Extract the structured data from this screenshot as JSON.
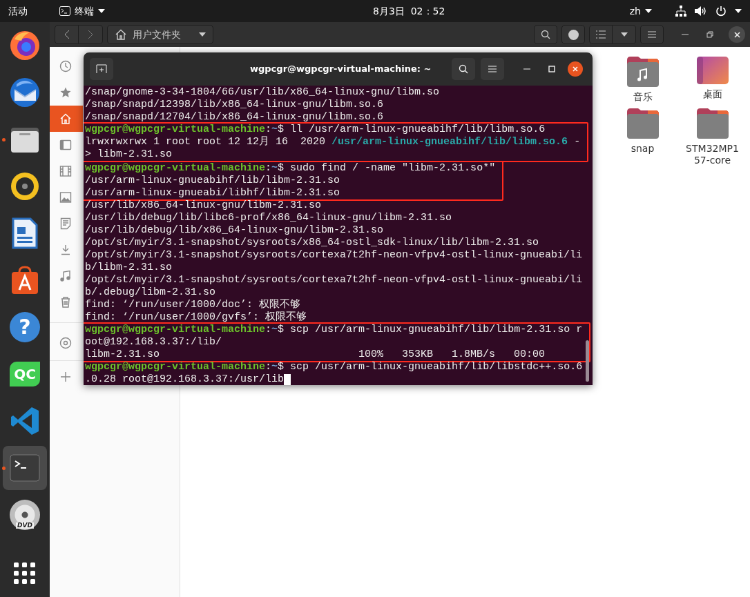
{
  "top_bar": {
    "activities": "活动",
    "app_name": "终端",
    "clock": "8月3日  02：52",
    "input_method": "zh"
  },
  "dock": [
    {
      "kind": "firefox",
      "running": false,
      "selected": false
    },
    {
      "kind": "thunderbird",
      "running": false,
      "selected": false
    },
    {
      "kind": "files",
      "running": true,
      "selected": false
    },
    {
      "kind": "rhythmbox",
      "running": false,
      "selected": false
    },
    {
      "kind": "writer",
      "running": false,
      "selected": false
    },
    {
      "kind": "software",
      "running": false,
      "selected": false
    },
    {
      "kind": "help",
      "label": "?",
      "running": false,
      "selected": false
    },
    {
      "kind": "qt",
      "label": "QC",
      "running": false,
      "selected": false
    },
    {
      "kind": "vscode",
      "running": false,
      "selected": false
    },
    {
      "kind": "terminal",
      "running": true,
      "selected": true
    },
    {
      "kind": "dvd",
      "label": "DVD",
      "running": false,
      "selected": false
    },
    {
      "kind": "apps",
      "running": false,
      "selected": false
    }
  ],
  "file_manager": {
    "location": "用户文件夹",
    "sidebar": [
      {
        "kind": "recent",
        "selected": false
      },
      {
        "kind": "starred",
        "selected": false
      },
      {
        "kind": "home",
        "selected": true
      },
      {
        "kind": "desktop",
        "selected": false
      },
      {
        "kind": "videos",
        "selected": false
      },
      {
        "kind": "pictures",
        "selected": false
      },
      {
        "kind": "documents",
        "selected": false
      },
      {
        "kind": "downloads",
        "selected": false
      },
      {
        "kind": "music",
        "selected": false
      },
      {
        "kind": "trash",
        "selected": false
      },
      {
        "kind": "disc",
        "selected": false
      },
      {
        "kind": "other",
        "selected": false
      }
    ],
    "files": [
      {
        "kind": "music",
        "name": "音乐"
      },
      {
        "kind": "desktop",
        "name": "桌面"
      },
      {
        "kind": "folder",
        "name": "snap"
      },
      {
        "kind": "folder",
        "name": "STM32MP157-core"
      }
    ]
  },
  "terminal": {
    "title": "wgpcgr@wgpcgr-virtual-machine: ~",
    "blocks": [
      {
        "highlighted": false,
        "lines": [
          [
            {
              "kind": "plain",
              "text": "/snap/gnome-3-34-1804/66/usr/lib/x86_64-linux-gnu/libm.so"
            }
          ],
          [
            {
              "kind": "plain",
              "text": "/snap/snapd/12398/lib/x86_64-linux-gnu/libm.so.6"
            }
          ],
          [
            {
              "kind": "plain",
              "text": "/snap/snapd/12704/lib/x86_64-linux-gnu/libm.so.6"
            }
          ]
        ]
      },
      {
        "highlighted": true,
        "lines": [
          [
            {
              "kind": "user",
              "text": "wgpcgr@wgpcgr-virtual-machine"
            },
            {
              "kind": "plain",
              "text": ":"
            },
            {
              "kind": "dir",
              "text": "~"
            },
            {
              "kind": "plain",
              "text": "$ ll /usr/arm-linux-gnueabihf/lib/libm.so.6"
            }
          ],
          [
            {
              "kind": "plain",
              "text": "lrwxrwxrwx 1 root root 12 12月 16  2020 "
            },
            {
              "kind": "link",
              "text": "/usr/arm-linux-gnueabihf/lib/libm.so.6"
            },
            {
              "kind": "plain",
              "text": " -"
            }
          ],
          [
            {
              "kind": "plain",
              "text": "> libm-2.31.so"
            }
          ]
        ]
      },
      {
        "highlighted": true,
        "lines": [
          [
            {
              "kind": "user",
              "text": "wgpcgr@wgpcgr-virtual-machine"
            },
            {
              "kind": "plain",
              "text": ":"
            },
            {
              "kind": "dir",
              "text": "~"
            },
            {
              "kind": "plain",
              "text": "$ sudo find / -name \"libm-2.31.so*\""
            }
          ],
          [
            {
              "kind": "plain",
              "text": "/usr/arm-linux-gnueabihf/lib/libm-2.31.so"
            }
          ],
          [
            {
              "kind": "plain",
              "text": "/usr/arm-linux-gnueabi/libhf/libm-2.31.so"
            }
          ]
        ]
      },
      {
        "highlighted": false,
        "lines": [
          [
            {
              "kind": "plain",
              "text": "/usr/lib/x86_64-linux-gnu/libm-2.31.so"
            }
          ],
          [
            {
              "kind": "plain",
              "text": "/usr/lib/debug/lib/libc6-prof/x86_64-linux-gnu/libm-2.31.so"
            }
          ],
          [
            {
              "kind": "plain",
              "text": "/usr/lib/debug/lib/x86_64-linux-gnu/libm-2.31.so"
            }
          ],
          [
            {
              "kind": "plain",
              "text": "/opt/st/myir/3.1-snapshot/sysroots/x86_64-ostl_sdk-linux/lib/libm-2.31.so"
            }
          ],
          [
            {
              "kind": "plain",
              "text": "/opt/st/myir/3.1-snapshot/sysroots/cortexa7t2hf-neon-vfpv4-ostl-linux-gnueabi/li"
            }
          ],
          [
            {
              "kind": "plain",
              "text": "b/libm-2.31.so"
            }
          ],
          [
            {
              "kind": "plain",
              "text": "/opt/st/myir/3.1-snapshot/sysroots/cortexa7t2hf-neon-vfpv4-ostl-linux-gnueabi/li"
            }
          ],
          [
            {
              "kind": "plain",
              "text": "b/.debug/libm-2.31.so"
            }
          ],
          [
            {
              "kind": "plain",
              "text": "find: ‘/run/user/1000/doc’: 权限不够"
            }
          ],
          [
            {
              "kind": "plain",
              "text": "find: ‘/run/user/1000/gvfs’: 权限不够"
            }
          ]
        ]
      },
      {
        "highlighted": true,
        "lines": [
          [
            {
              "kind": "user",
              "text": "wgpcgr@wgpcgr-virtual-machine"
            },
            {
              "kind": "plain",
              "text": ":"
            },
            {
              "kind": "dir",
              "text": "~"
            },
            {
              "kind": "plain",
              "text": "$ scp /usr/arm-linux-gnueabihf/lib/libm-2.31.so r"
            }
          ],
          [
            {
              "kind": "plain",
              "text": "oot@192.168.3.37:/lib/"
            }
          ],
          [
            {
              "kind": "plain",
              "text": "libm-2.31.so                                100%   353KB   1.8MB/s   00:00"
            }
          ]
        ]
      },
      {
        "highlighted": false,
        "cursor": true,
        "lines": [
          [
            {
              "kind": "user",
              "text": "wgpcgr@wgpcgr-virtual-machine"
            },
            {
              "kind": "plain",
              "text": ":"
            },
            {
              "kind": "dir",
              "text": "~"
            },
            {
              "kind": "plain",
              "text": "$ scp /usr/arm-linux-gnueabihf/lib/libstdc++.so.6"
            }
          ],
          [
            {
              "kind": "plain",
              "text": ".0.28 root@192.168.3.37:/usr/lib"
            }
          ]
        ]
      }
    ]
  }
}
